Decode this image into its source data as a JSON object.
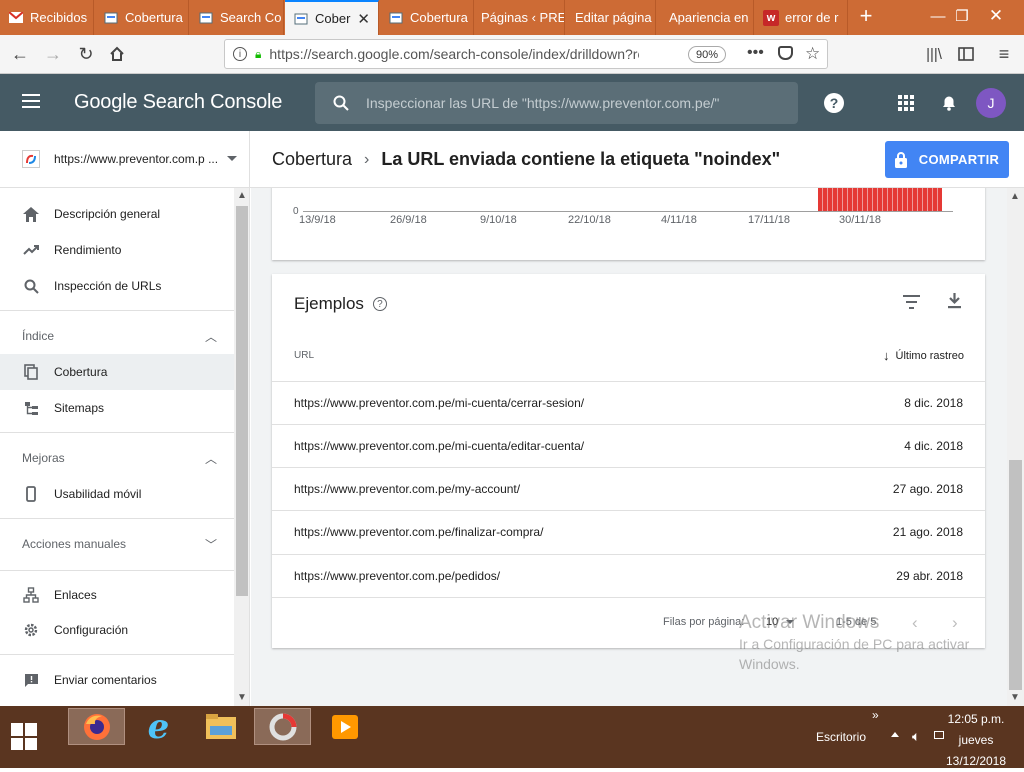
{
  "browser": {
    "tabs": [
      {
        "label": "Recibidos",
        "icon": "gmail-icon"
      },
      {
        "label": "Cobertura",
        "icon": "search-console-icon"
      },
      {
        "label": "Search Co",
        "icon": "search-console-icon"
      },
      {
        "label": "Cober",
        "icon": "search-console-icon",
        "active": true
      },
      {
        "label": "Cobertura",
        "icon": "search-console-icon"
      },
      {
        "label": "Páginas ‹ PRE",
        "icon": ""
      },
      {
        "label": "Editar página",
        "icon": ""
      },
      {
        "label": "Apariencia en",
        "icon": ""
      },
      {
        "label": "error de r",
        "icon": "woocommerce-icon"
      }
    ],
    "url": "https://search.google.com/search-console/index/drilldown?re",
    "url_domain": "google.com",
    "zoom": "90%"
  },
  "app": {
    "logo": "Google Search Console",
    "search_placeholder": "Inspeccionar las URL de \"https://www.preventor.com.pe/\"",
    "avatar_letter": "J"
  },
  "subheader": {
    "property": "https://www.preventor.com.p ...",
    "breadcrumb_parent": "Cobertura",
    "breadcrumb_current": "La URL enviada contiene la etiqueta \"noindex\"",
    "share_label": "COMPARTIR"
  },
  "sidebar": {
    "items_top": [
      {
        "label": "Descripción general",
        "icon": "home-icon"
      },
      {
        "label": "Rendimiento",
        "icon": "trending-up-icon"
      },
      {
        "label": "Inspección de URLs",
        "icon": "search-icon"
      }
    ],
    "section_index": "Índice",
    "items_index": [
      {
        "label": "Cobertura",
        "icon": "coverage-icon",
        "active": true
      },
      {
        "label": "Sitemaps",
        "icon": "sitemap-icon"
      }
    ],
    "section_improvements": "Mejoras",
    "items_improvements": [
      {
        "label": "Usabilidad móvil",
        "icon": "smartphone-icon"
      }
    ],
    "section_manual": "Acciones manuales",
    "items_bottom": [
      {
        "label": "Enlaces",
        "icon": "links-icon"
      },
      {
        "label": "Configuración",
        "icon": "settings-icon"
      }
    ],
    "feedback": "Enviar comentarios"
  },
  "chart": {
    "zero_label": "0",
    "ticks": [
      "13/9/18",
      "26/9/18",
      "9/10/18",
      "22/10/18",
      "4/11/18",
      "17/11/18",
      "30/11/18"
    ]
  },
  "examples": {
    "title": "Ejemplos",
    "col_url": "URL",
    "col_last": "Último rastreo",
    "rows": [
      {
        "url": "https://www.preventor.com.pe/mi-cuenta/cerrar-sesion/",
        "date": "8 dic. 2018"
      },
      {
        "url": "https://www.preventor.com.pe/mi-cuenta/editar-cuenta/",
        "date": "4 dic. 2018"
      },
      {
        "url": "https://www.preventor.com.pe/my-account/",
        "date": "27 ago. 2018"
      },
      {
        "url": "https://www.preventor.com.pe/finalizar-compra/",
        "date": "21 ago. 2018"
      },
      {
        "url": "https://www.preventor.com.pe/pedidos/",
        "date": "29 abr. 2018"
      }
    ],
    "rows_per_page_label": "Filas por página:",
    "rows_per_page": "10",
    "range": "1-5 de 5"
  },
  "watermark": {
    "line1": "Activar Windows",
    "line2": "Ir a Configuración de PC para activar",
    "line3": "Windows."
  },
  "taskbar": {
    "desktop_label": "Escritorio",
    "time": "12:05 p.m.",
    "day": "jueves",
    "date": "13/12/2018"
  },
  "colors": {
    "tab_bar": "#cd6b35",
    "header": "#455a64",
    "accent": "#4285f4",
    "bars": "#e53935",
    "taskbar": "#5a3520"
  }
}
